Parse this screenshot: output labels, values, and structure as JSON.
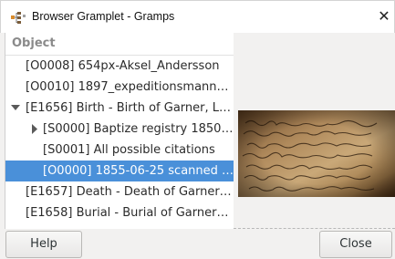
{
  "window": {
    "title": "Browser Gramplet - Gramps",
    "close_glyph": "✕",
    "app_icon": "gramps-tree-icon"
  },
  "tree": {
    "column_header": "Object",
    "rows": [
      {
        "text": "[O0008] 654px-Aksel_Andersson",
        "expander": "none",
        "selected": false
      },
      {
        "text": "[O0010] 1897_expeditionsmann…",
        "expander": "none",
        "selected": false
      },
      {
        "text": "[E1656] Birth - Birth of Garner, L…",
        "expander": "expanded",
        "selected": false
      },
      {
        "text": "[S0000] Baptize registry 1850…",
        "expander": "collapsed",
        "selected": false
      },
      {
        "text": "[S0001] All possible citations",
        "expander": "none",
        "selected": false
      },
      {
        "text": "[O0000] 1855-06-25 scanned …",
        "expander": "none",
        "selected": true
      },
      {
        "text": "[E1657] Death - Death of Garner…",
        "expander": "none",
        "selected": false
      },
      {
        "text": "[E1658] Burial - Burial of Garner…",
        "expander": "none",
        "selected": false
      }
    ]
  },
  "preview": {
    "image_name": "scanned-handwritten-document-thumbnail"
  },
  "buttons": {
    "help_label": "Help",
    "close_label": "Close"
  },
  "colors": {
    "selection": "#4a90d9",
    "header_text": "#8a8a8a",
    "dialog_bg": "#f2f1f0"
  }
}
